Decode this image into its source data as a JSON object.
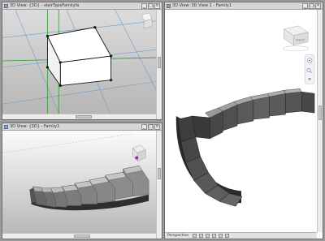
{
  "windows": {
    "top_left": {
      "title": "3D View: {3D} - stairTypeFamilyfa"
    },
    "bottom_left": {
      "title": "3D View: {3D} - Family1"
    },
    "right": {
      "title": "3D View: 3D View 1 - Family1",
      "status": "Perspective"
    }
  },
  "viewcube": {
    "label": "RIGHT"
  },
  "colors": {
    "stair_dark": "#2e2e2e",
    "stair_light": "#a9a9a9",
    "grid_line": "#6e9ec9",
    "ref_line": "#2f9a2f",
    "window_frame": "#6d6d6d"
  }
}
